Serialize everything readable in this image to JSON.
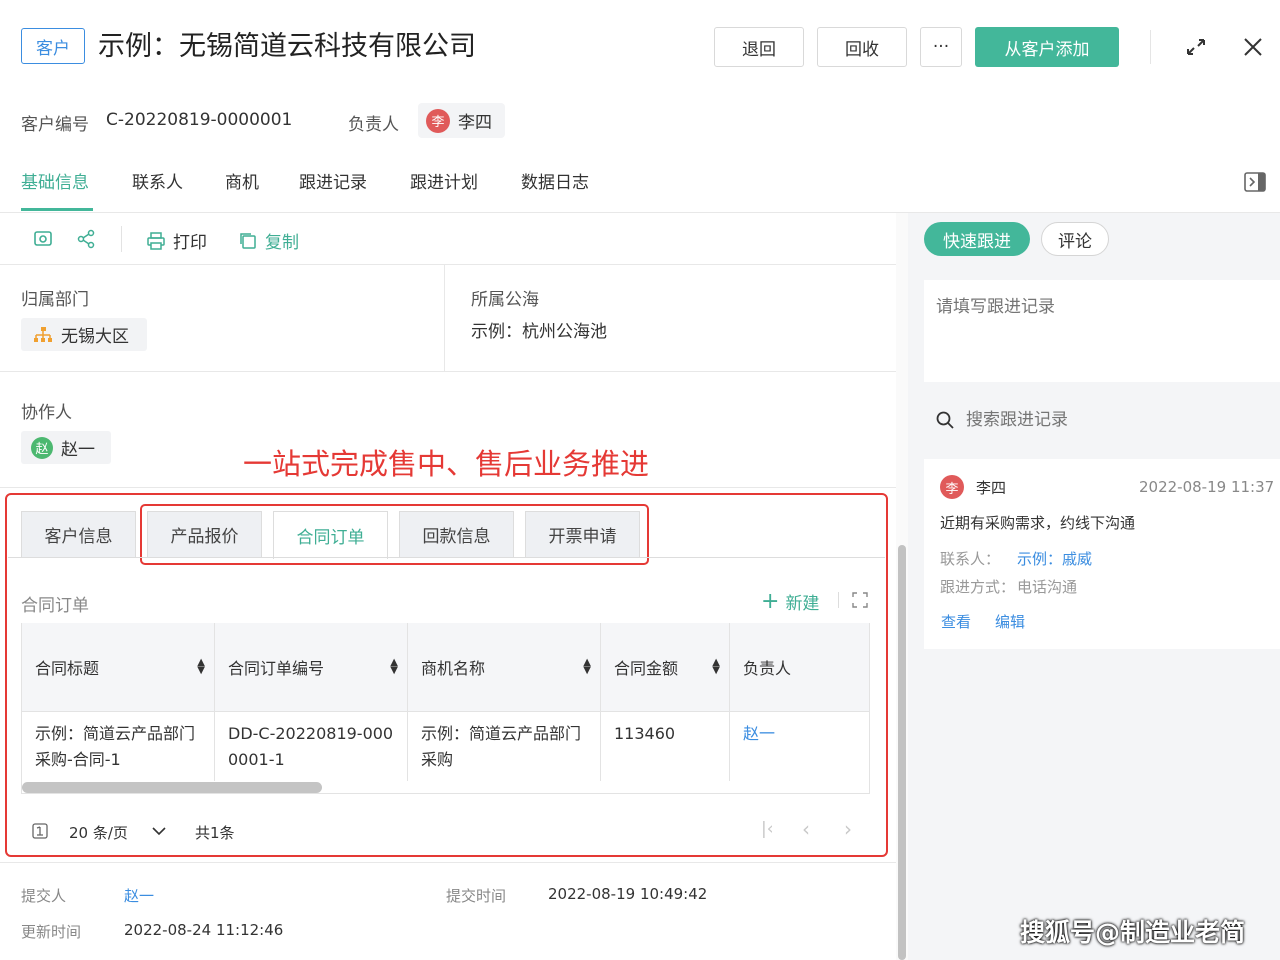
{
  "header": {
    "tag": "客户",
    "title": "示例：无锡简道云科技有限公司",
    "btn_return": "退回",
    "btn_recycle": "回收",
    "btn_more": "···",
    "btn_add": "从客户添加"
  },
  "meta": {
    "customer_no_label": "客户编号",
    "customer_no": "C-20220819-0000001",
    "owner_label": "负责人",
    "owner_avatar": "李",
    "owner_name": "李四"
  },
  "tabs": [
    "基础信息",
    "联系人",
    "商机",
    "跟进记录",
    "跟进计划",
    "数据日志"
  ],
  "toolbar": {
    "print": "打印",
    "copy": "复制"
  },
  "fields": {
    "dept_label": "归属部门",
    "dept_value": "无锡大区",
    "pool_label": "所属公海",
    "pool_value": "示例：杭州公海池",
    "collab_label": "协作人",
    "collab_avatar": "赵",
    "collab_name": "赵一"
  },
  "annotation": "一站式完成售中、售后业务推进",
  "subtabs": [
    "客户信息",
    "产品报价",
    "合同订单",
    "回款信息",
    "开票申请"
  ],
  "section": {
    "title": "合同订单",
    "new_label": "新建"
  },
  "table": {
    "headers": [
      "合同标题",
      "合同订单编号",
      "商机名称",
      "合同金额",
      "负责人"
    ],
    "rows": [
      [
        "示例：简道云产品部门采购-合同-1",
        "DD-C-20220819-0000001-1",
        "示例：简道云产品部门采购",
        "113460",
        "赵一"
      ]
    ]
  },
  "pagination": {
    "page_size": "20 条/页",
    "total": "共1条"
  },
  "footer": {
    "submitter_label": "提交人",
    "submitter": "赵一",
    "submit_time_label": "提交时间",
    "submit_time": "2022-08-19 10:49:42",
    "update_time_label": "更新时间",
    "update_time": "2022-08-24 11:12:46"
  },
  "right": {
    "btn_quick": "快速跟进",
    "btn_comment": "评论",
    "placeholder": "请填写跟进记录",
    "search_placeholder": "搜索跟进记录",
    "record": {
      "avatar": "李",
      "name": "李四",
      "time": "2022-08-19 11:37",
      "content": "近期有采购需求，约线下沟通",
      "contact_label": "联系人：",
      "contact_value": "示例：戚威",
      "method_label": "跟进方式：",
      "method_value": "电话沟通",
      "view": "查看",
      "edit": "编辑"
    }
  },
  "watermark_text": "搜狐号@制造业老简",
  "colors": {
    "accent": "#43b79a",
    "link": "#3b8de0",
    "annotation": "#e53935"
  }
}
